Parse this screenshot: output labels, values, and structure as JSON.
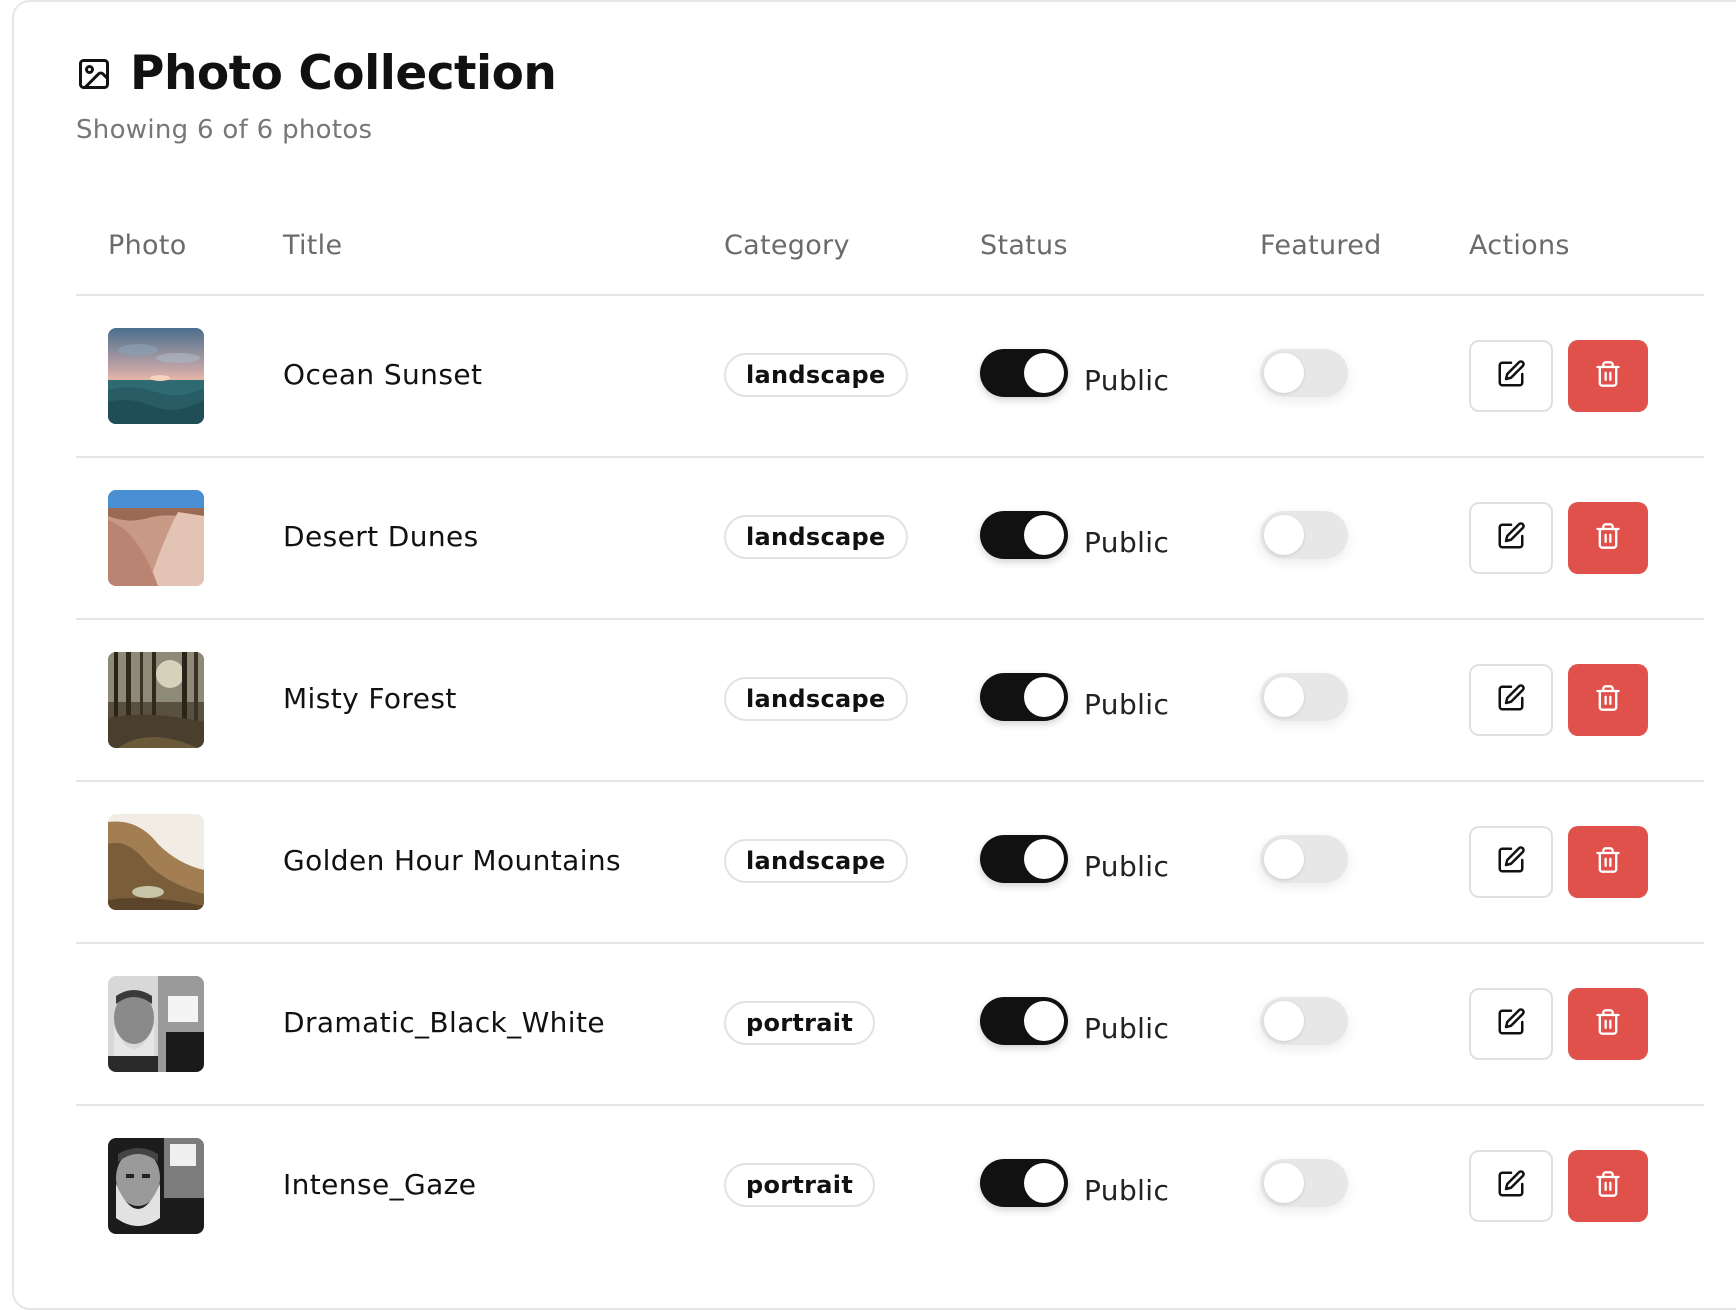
{
  "header": {
    "title": "Photo Collection",
    "subtitle": "Showing 6 of 6 photos",
    "icon": "image-icon"
  },
  "columns": [
    "Photo",
    "Title",
    "Category",
    "Status",
    "Featured",
    "Actions"
  ],
  "colors": {
    "toggle_on": "#111111",
    "toggle_off": "#e7e7e7",
    "delete": "#e0514b"
  },
  "photos": [
    {
      "title": "Ocean Sunset",
      "category": "landscape",
      "status_label": "Public",
      "public": true,
      "featured": false
    },
    {
      "title": "Desert Dunes",
      "category": "landscape",
      "status_label": "Public",
      "public": true,
      "featured": false
    },
    {
      "title": "Misty Forest",
      "category": "landscape",
      "status_label": "Public",
      "public": true,
      "featured": false
    },
    {
      "title": "Golden Hour Mountains",
      "category": "landscape",
      "status_label": "Public",
      "public": true,
      "featured": false
    },
    {
      "title": "Dramatic_Black_White",
      "category": "portrait",
      "status_label": "Public",
      "public": true,
      "featured": false
    },
    {
      "title": "Intense_Gaze",
      "category": "portrait",
      "status_label": "Public",
      "public": true,
      "featured": false
    }
  ]
}
